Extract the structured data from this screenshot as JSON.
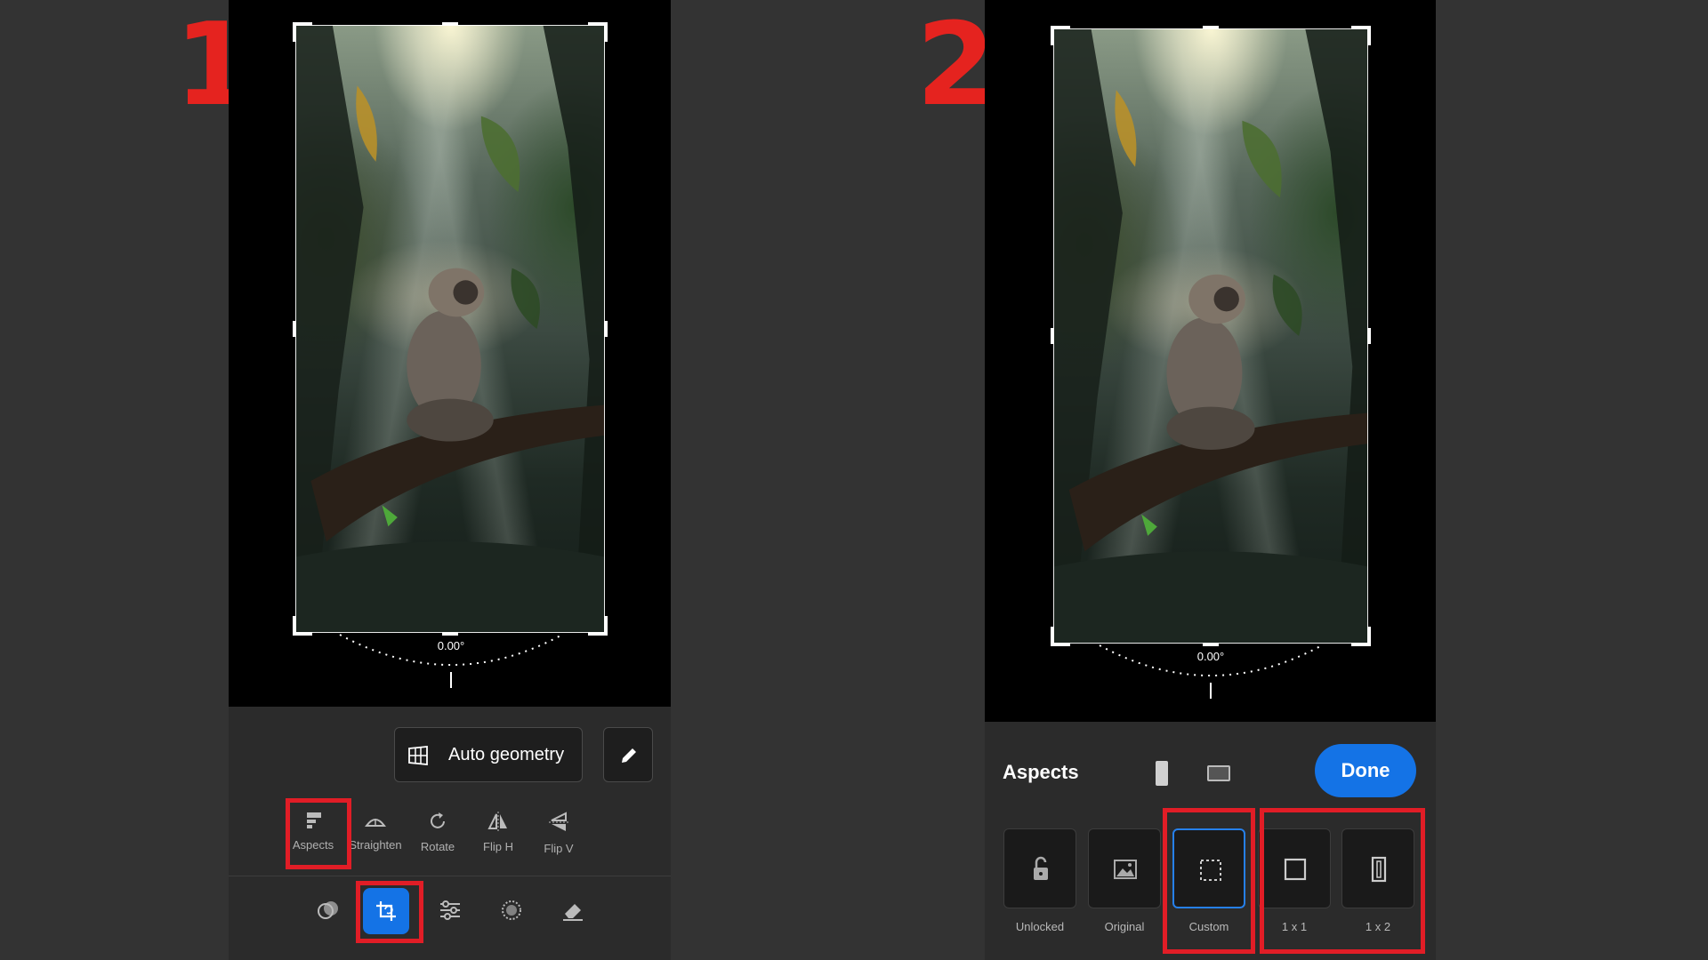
{
  "steps": {
    "first": "1",
    "second": "2"
  },
  "panel1": {
    "angle": "0.00°",
    "auto_geometry_label": "Auto geometry",
    "tools": [
      {
        "label": "Aspects",
        "icon": "aspects-icon"
      },
      {
        "label": "Straighten",
        "icon": "straighten-icon"
      },
      {
        "label": "Rotate",
        "icon": "rotate-icon"
      },
      {
        "label": "Flip H",
        "icon": "flip-horizontal-icon"
      },
      {
        "label": "Flip V",
        "icon": "flip-vertical-icon"
      }
    ],
    "bottom_tools": [
      "mix-icon",
      "crop-icon",
      "adjust-icon",
      "effects-icon",
      "eraser-icon"
    ],
    "active_bottom_tool": "crop-icon"
  },
  "panel2": {
    "angle": "0.00°",
    "aspects_title": "Aspects",
    "done_label": "Done",
    "aspect_options": [
      {
        "label": "Unlocked",
        "icon": "unlock-icon"
      },
      {
        "label": "Original",
        "icon": "image-icon"
      },
      {
        "label": "Custom",
        "icon": "custom-crop-icon"
      },
      {
        "label": "1 x 1",
        "icon": "square-icon"
      },
      {
        "label": "1 x 2",
        "icon": "tall-rectangle-icon"
      }
    ],
    "selected_aspect": "Custom"
  },
  "colors": {
    "background": "#333333",
    "highlight": "#e11d26",
    "accent_blue": "#1473e6",
    "toolbar": "#2b2b2b"
  }
}
